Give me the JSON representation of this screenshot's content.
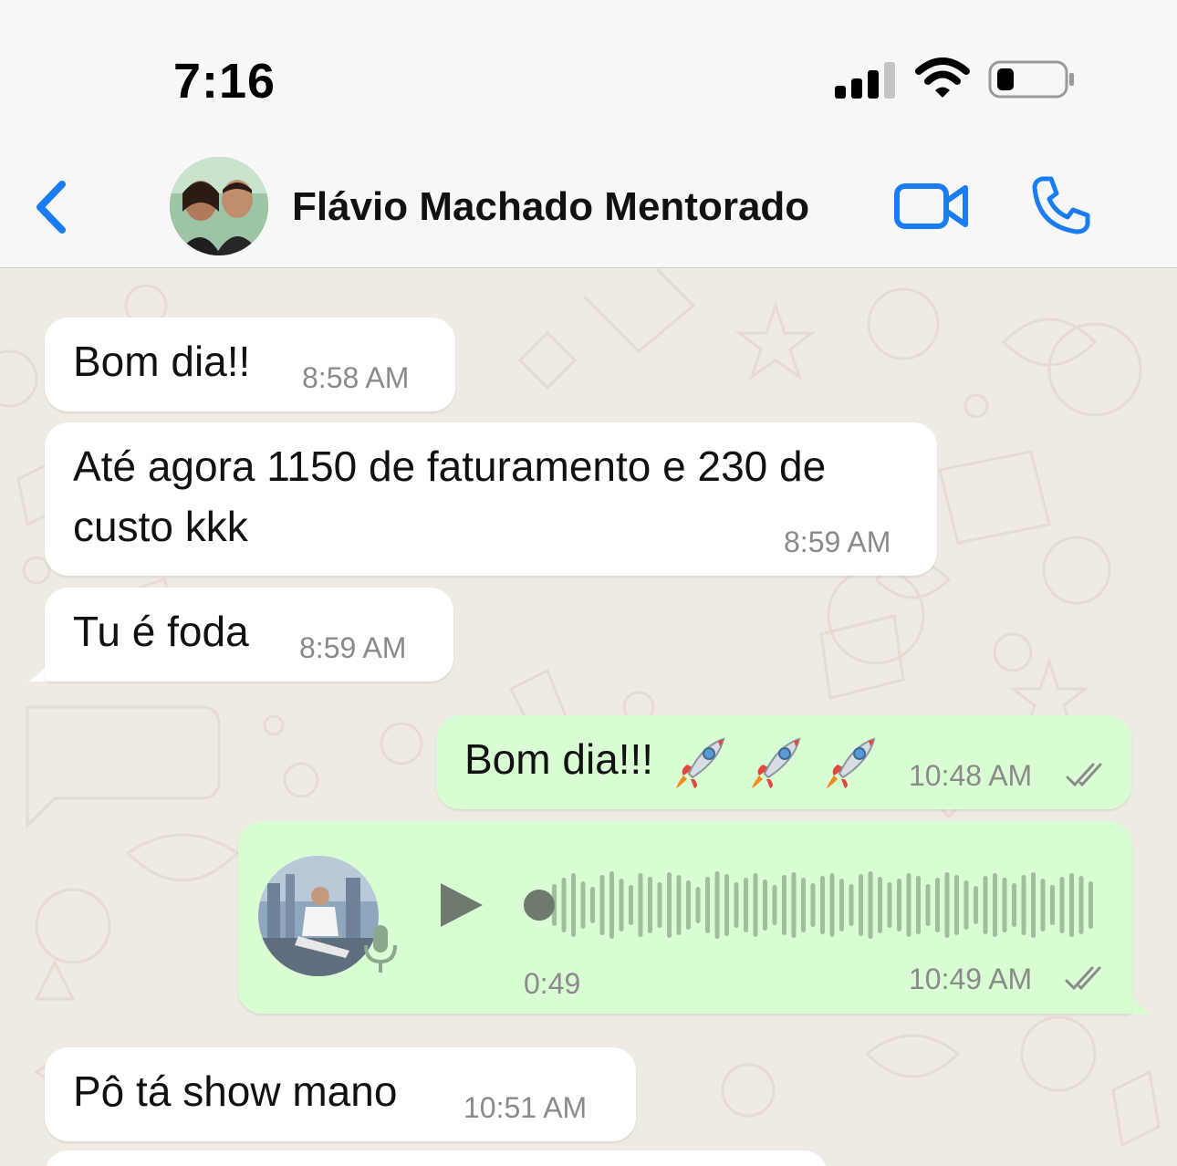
{
  "status_bar": {
    "time": "7:16"
  },
  "header": {
    "back_icon": "chevron-left-icon",
    "contact_name": "Flávio Machado Mentorado",
    "video_icon": "video-camera-icon",
    "call_icon": "phone-icon",
    "accent_color": "#1a7cf2"
  },
  "messages": [
    {
      "direction": "incoming",
      "text": "Bom dia!!",
      "time": "8:58 AM"
    },
    {
      "direction": "incoming",
      "text_line1": "Até agora 1150 de faturamento e 230 de",
      "text_line2": "custo kkk",
      "time": "8:59 AM"
    },
    {
      "direction": "incoming",
      "text": "Tu é foda",
      "time": "8:59 AM"
    },
    {
      "direction": "outgoing",
      "text": "Bom dia!!!",
      "emoji": "rocket-icon",
      "emoji_count": 3,
      "time": "10:48 AM",
      "status": "read"
    },
    {
      "direction": "outgoing",
      "type": "voice",
      "duration": "0:49",
      "time": "10:49 AM",
      "status": "read"
    },
    {
      "direction": "incoming",
      "text": "Pô tá show mano",
      "time": "10:51 AM"
    }
  ],
  "colors": {
    "incoming_bubble": "#ffffff",
    "outgoing_bubble": "#d9fdd3",
    "chat_background": "#efeae2"
  }
}
